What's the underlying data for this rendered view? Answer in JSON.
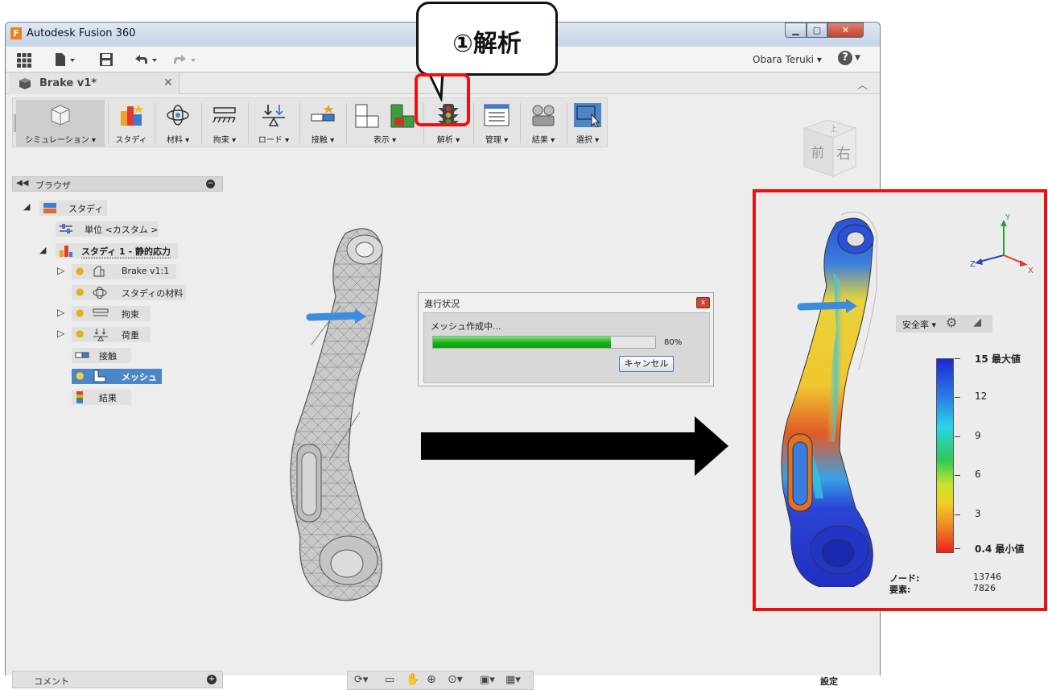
{
  "window": {
    "title": "Autodesk Fusion 360",
    "logo": "F",
    "min_glyph": "▁",
    "max_glyph": "▢",
    "close_glyph": "✕"
  },
  "qat": {
    "user": "Obara Teruki ▾",
    "help": "?"
  },
  "doc_tab": {
    "label": "Brake v1*",
    "close": "✕",
    "collapse": "︿"
  },
  "ribbon": {
    "simulation": "シミュレーション ▾",
    "study": "スタディ",
    "material": "材料 ▾",
    "constraint": "拘束 ▾",
    "load": "ロード ▾",
    "contact": "接触 ▾",
    "display": "表示 ▾",
    "solve": "解析 ▾",
    "manage": "管理 ▾",
    "results": "結果 ▾",
    "select": "選択 ▾"
  },
  "viewcube": {
    "front": "前",
    "right": "右",
    "top": "上"
  },
  "browser": {
    "title": "ブラウザ",
    "items": [
      {
        "label": "スタディ"
      },
      {
        "label": "単位 <カスタム >"
      },
      {
        "label": "スタディ 1 - 静的応力"
      },
      {
        "label": "Brake v1:1"
      },
      {
        "label": "スタディの材料"
      },
      {
        "label": "拘束"
      },
      {
        "label": "荷重"
      },
      {
        "label": "接触"
      },
      {
        "label": "メッシュ"
      },
      {
        "label": "結果"
      }
    ]
  },
  "comment": {
    "label": "コメント"
  },
  "settings": "設定",
  "dialog": {
    "title": "進行状況",
    "close": "x",
    "message": "メッシュ作成中...",
    "progress": 0.8,
    "percent_text": "80%",
    "cancel": "キャンセル"
  },
  "callout": {
    "text": "①解析"
  },
  "result": {
    "safety_label": "安全率 ▾",
    "legend": [
      {
        "text": "15 最大値",
        "value": 15
      },
      {
        "text": "12",
        "value": 12
      },
      {
        "text": "9",
        "value": 9
      },
      {
        "text": "6",
        "value": 6
      },
      {
        "text": "3",
        "value": 3
      },
      {
        "text": "0.4 最小値",
        "value": 0.4
      }
    ],
    "nodes_label": "ノード:",
    "nodes_value": "13746",
    "elements_label": "要素:",
    "elements_value": "7826",
    "axes": {
      "y": "Y",
      "z": "Z",
      "x": "X"
    }
  },
  "colors": {
    "highlight": "#ee1010",
    "accent": "#4d86c6",
    "progress": "#18b318"
  }
}
